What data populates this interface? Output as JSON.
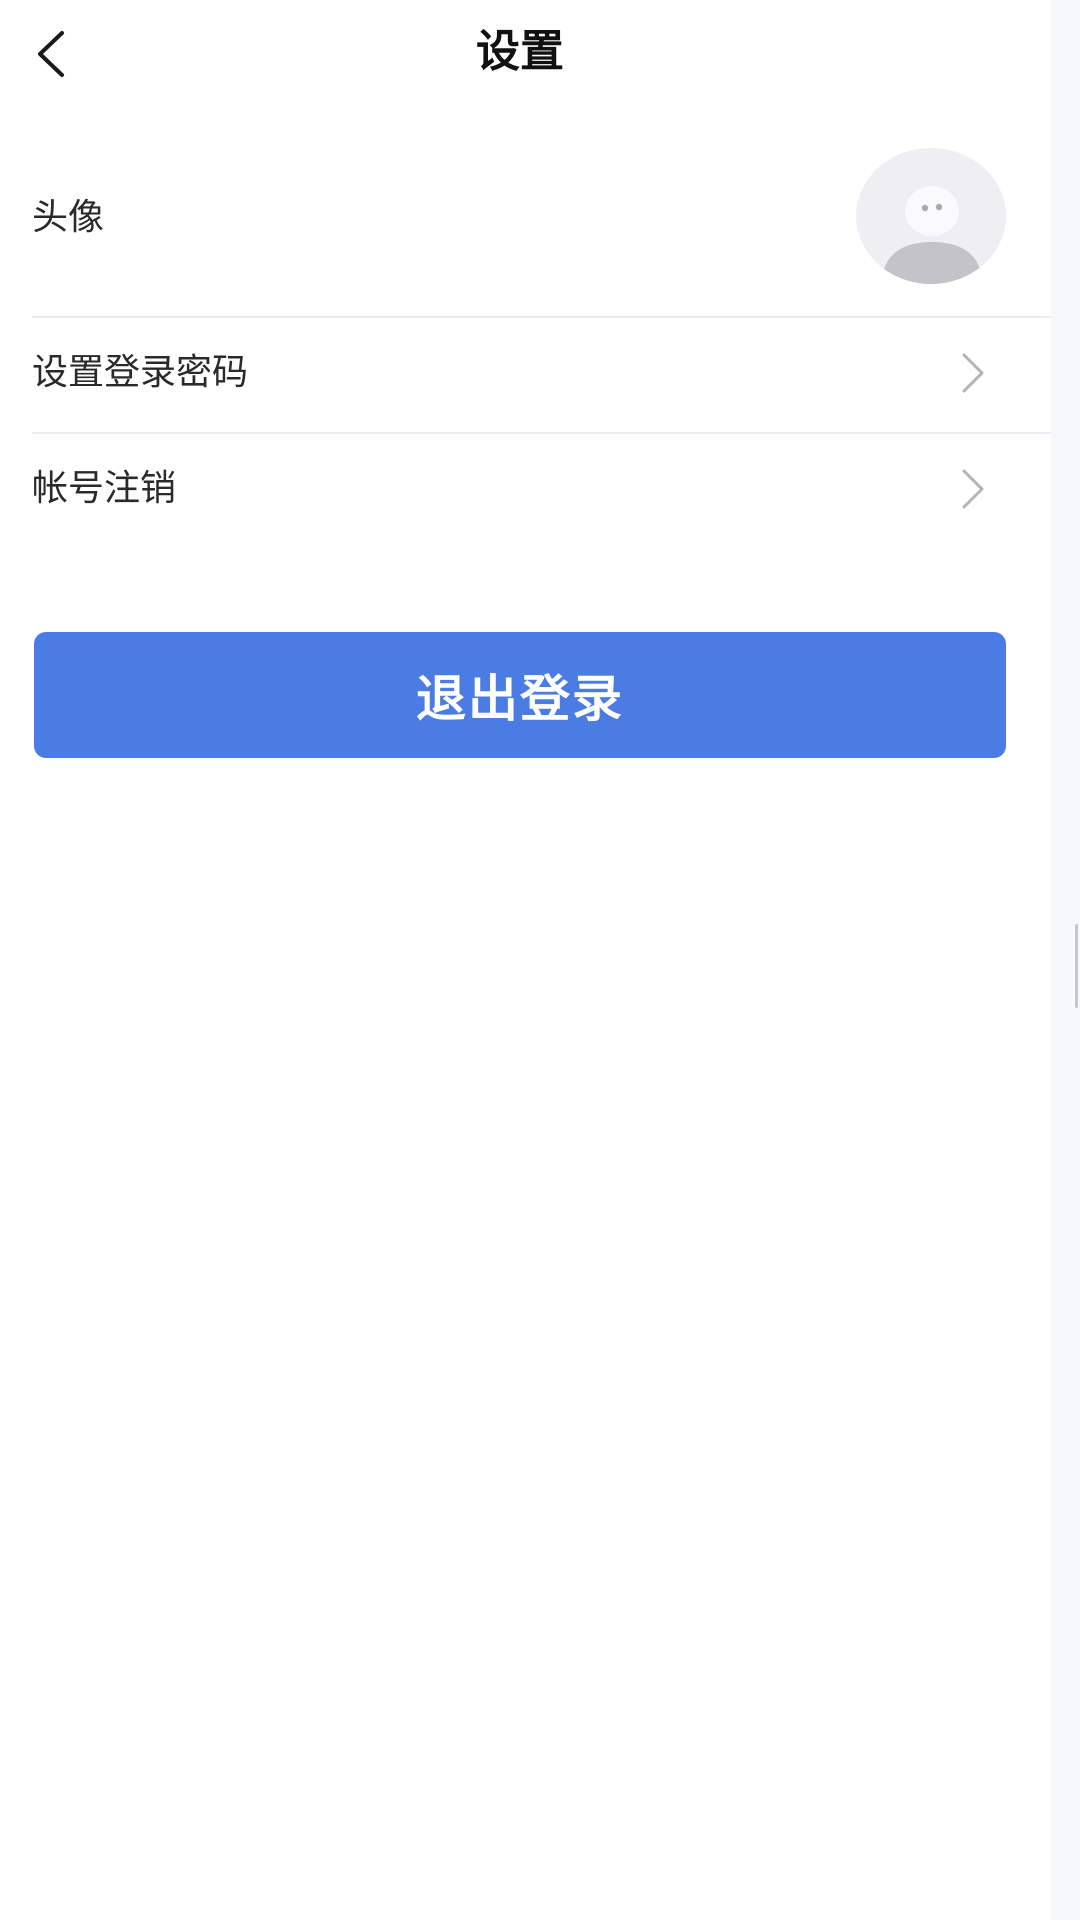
{
  "header": {
    "title": "设置",
    "back_icon": "chevron-left-icon"
  },
  "settings": {
    "avatar_label": "头像",
    "items": [
      {
        "label": "设置登录密码",
        "icon": "chevron-right-icon"
      },
      {
        "label": "帐号注销",
        "icon": "chevron-right-icon"
      }
    ]
  },
  "actions": {
    "logout_label": "退出登录"
  },
  "colors": {
    "primary": "#4a7ce4",
    "divider": "#ececef",
    "avatar_bg": "#efeff3",
    "chevron": "#b4b4b8"
  }
}
